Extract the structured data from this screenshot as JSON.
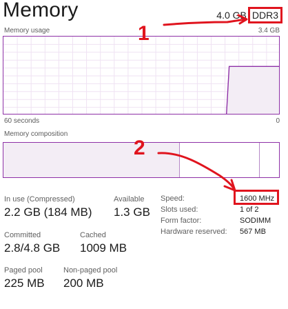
{
  "header": {
    "title": "Memory",
    "capacity": "4.0 GB",
    "memory_type": "DDR3"
  },
  "usage_graph": {
    "label": "Memory usage",
    "max_label": "3.4 GB",
    "time_label": "60 seconds",
    "min_label": "0",
    "usage_fraction_recent": 0.62,
    "line_color": "#8d2fa6",
    "fill_color": "#f3edf5"
  },
  "composition": {
    "label": "Memory composition",
    "in_use_fraction": 0.64,
    "standby_fraction": 0.29,
    "free_fraction": 0.07
  },
  "stats": {
    "in_use_label": "In use (Compressed)",
    "in_use_value": "2.2 GB (184 MB)",
    "available_label": "Available",
    "available_value": "1.3 GB",
    "committed_label": "Committed",
    "committed_value": "2.8/4.8 GB",
    "cached_label": "Cached",
    "cached_value": "1009 MB",
    "paged_pool_label": "Paged pool",
    "paged_pool_value": "225 MB",
    "non_paged_pool_label": "Non-paged pool",
    "non_paged_pool_value": "200 MB"
  },
  "details": [
    {
      "key": "Speed:",
      "value": "1600 MHz"
    },
    {
      "key": "Slots used:",
      "value": "1 of 2"
    },
    {
      "key": "Form factor:",
      "value": "SODIMM"
    },
    {
      "key": "Hardware reserved:",
      "value": "567 MB"
    }
  ],
  "annotations": {
    "marker_1": "1",
    "marker_2": "2",
    "highlight_color": "#e0141e"
  }
}
